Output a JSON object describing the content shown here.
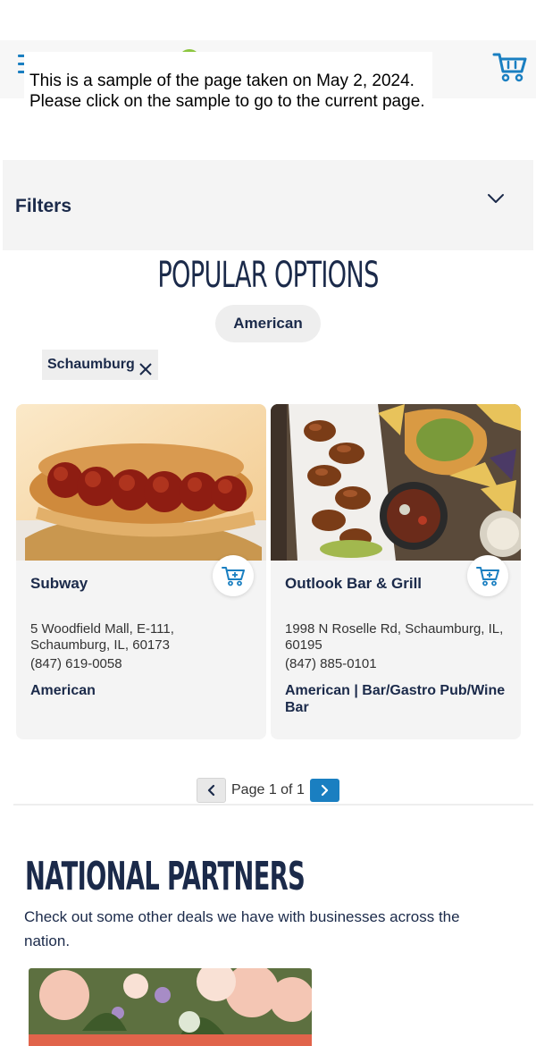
{
  "banner": {
    "line1": "This is a sample of the page taken on May 2, 2024.",
    "line2": "Please click on the sample to go to the current page."
  },
  "filters": {
    "label": "Filters"
  },
  "popular": {
    "title": "POPULAR OPTIONS",
    "category_chip": "American",
    "location_chip": "Schaumburg"
  },
  "cards": [
    {
      "name": "Subway",
      "address": "5 Woodfield Mall, E-111, Schaumburg, IL, 60173",
      "phone": "(847) 619-0058",
      "cuisine": "American"
    },
    {
      "name": "Outlook Bar & Grill",
      "address": "1998 N Roselle Rd, Schaumburg, IL, 60195",
      "phone": "(847) 885-0101",
      "cuisine": "American | Bar/Gastro Pub/Wine Bar"
    }
  ],
  "pagination": {
    "text": "Page 1 of 1"
  },
  "national_partners": {
    "title": "NATIONAL PARTNERS",
    "description": "Check out some other deals we have with businesses across the nation."
  },
  "icons": {
    "menu": "hamburger-menu-icon",
    "cart": "shopping-cart-icon",
    "chevron": "chevron-down-icon",
    "close": "close-icon",
    "add_to_cart": "add-to-cart-icon",
    "prev": "chevron-left-icon",
    "next": "chevron-right-icon"
  },
  "colors": {
    "accent": "#1a7fc1",
    "navy": "#1b2a4a",
    "panel": "#f4f4f4"
  }
}
